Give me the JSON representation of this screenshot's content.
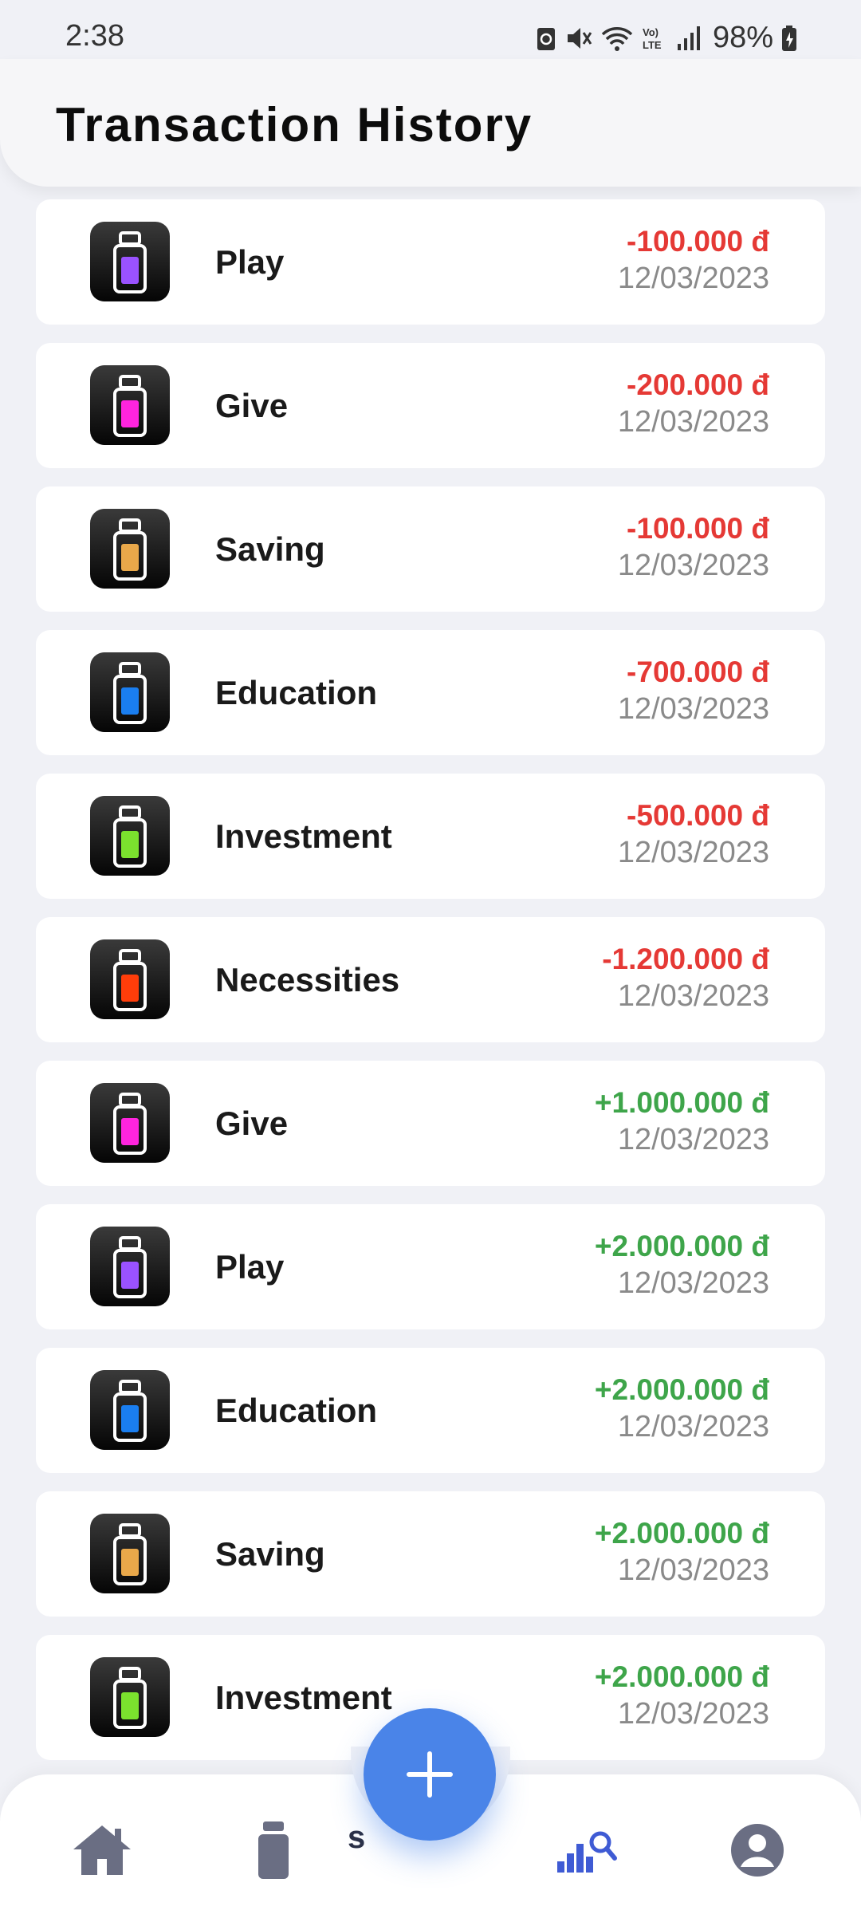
{
  "status_bar": {
    "time": "2:38",
    "battery": "98%"
  },
  "header": {
    "title": "Transaction History"
  },
  "colors": {
    "play": "#9a52ff",
    "give": "#ff24de",
    "saving": "#e9a84a",
    "education": "#1a7ef0",
    "investment": "#7be12e",
    "necessities": "#ff3d0a",
    "negative": "#e53935",
    "positive": "#3ea54a",
    "fab": "#4a84e8",
    "nav_active": "#3f5bd4",
    "nav_inactive": "#6a6e83"
  },
  "transactions": [
    {
      "category": "Play",
      "amount": "-100.000 đ",
      "date": "12/03/2023",
      "type": "negative",
      "color": "#9a52ff"
    },
    {
      "category": "Give",
      "amount": "-200.000 đ",
      "date": "12/03/2023",
      "type": "negative",
      "color": "#ff24de"
    },
    {
      "category": "Saving",
      "amount": "-100.000 đ",
      "date": "12/03/2023",
      "type": "negative",
      "color": "#e9a84a"
    },
    {
      "category": "Education",
      "amount": "-700.000 đ",
      "date": "12/03/2023",
      "type": "negative",
      "color": "#1a7ef0"
    },
    {
      "category": "Investment",
      "amount": "-500.000 đ",
      "date": "12/03/2023",
      "type": "negative",
      "color": "#7be12e"
    },
    {
      "category": "Necessities",
      "amount": "-1.200.000 đ",
      "date": "12/03/2023",
      "type": "negative",
      "color": "#ff3d0a"
    },
    {
      "category": "Give",
      "amount": "+1.000.000 đ",
      "date": "12/03/2023",
      "type": "positive",
      "color": "#ff24de"
    },
    {
      "category": "Play",
      "amount": "+2.000.000 đ",
      "date": "12/03/2023",
      "type": "positive",
      "color": "#9a52ff"
    },
    {
      "category": "Education",
      "amount": "+2.000.000 đ",
      "date": "12/03/2023",
      "type": "positive",
      "color": "#1a7ef0"
    },
    {
      "category": "Saving",
      "amount": "+2.000.000 đ",
      "date": "12/03/2023",
      "type": "positive",
      "color": "#e9a84a"
    },
    {
      "category": "Investment",
      "amount": "+2.000.000 đ",
      "date": "12/03/2023",
      "type": "positive",
      "color": "#7be12e"
    }
  ],
  "bottom_nav": {
    "items": [
      {
        "icon": "home-icon",
        "active": false
      },
      {
        "icon": "jar-icon",
        "active": false
      },
      {
        "icon": "stats-search-icon",
        "active": true
      },
      {
        "icon": "profile-icon",
        "active": false
      }
    ],
    "partial_label": "s",
    "fab_icon": "plus-icon"
  }
}
